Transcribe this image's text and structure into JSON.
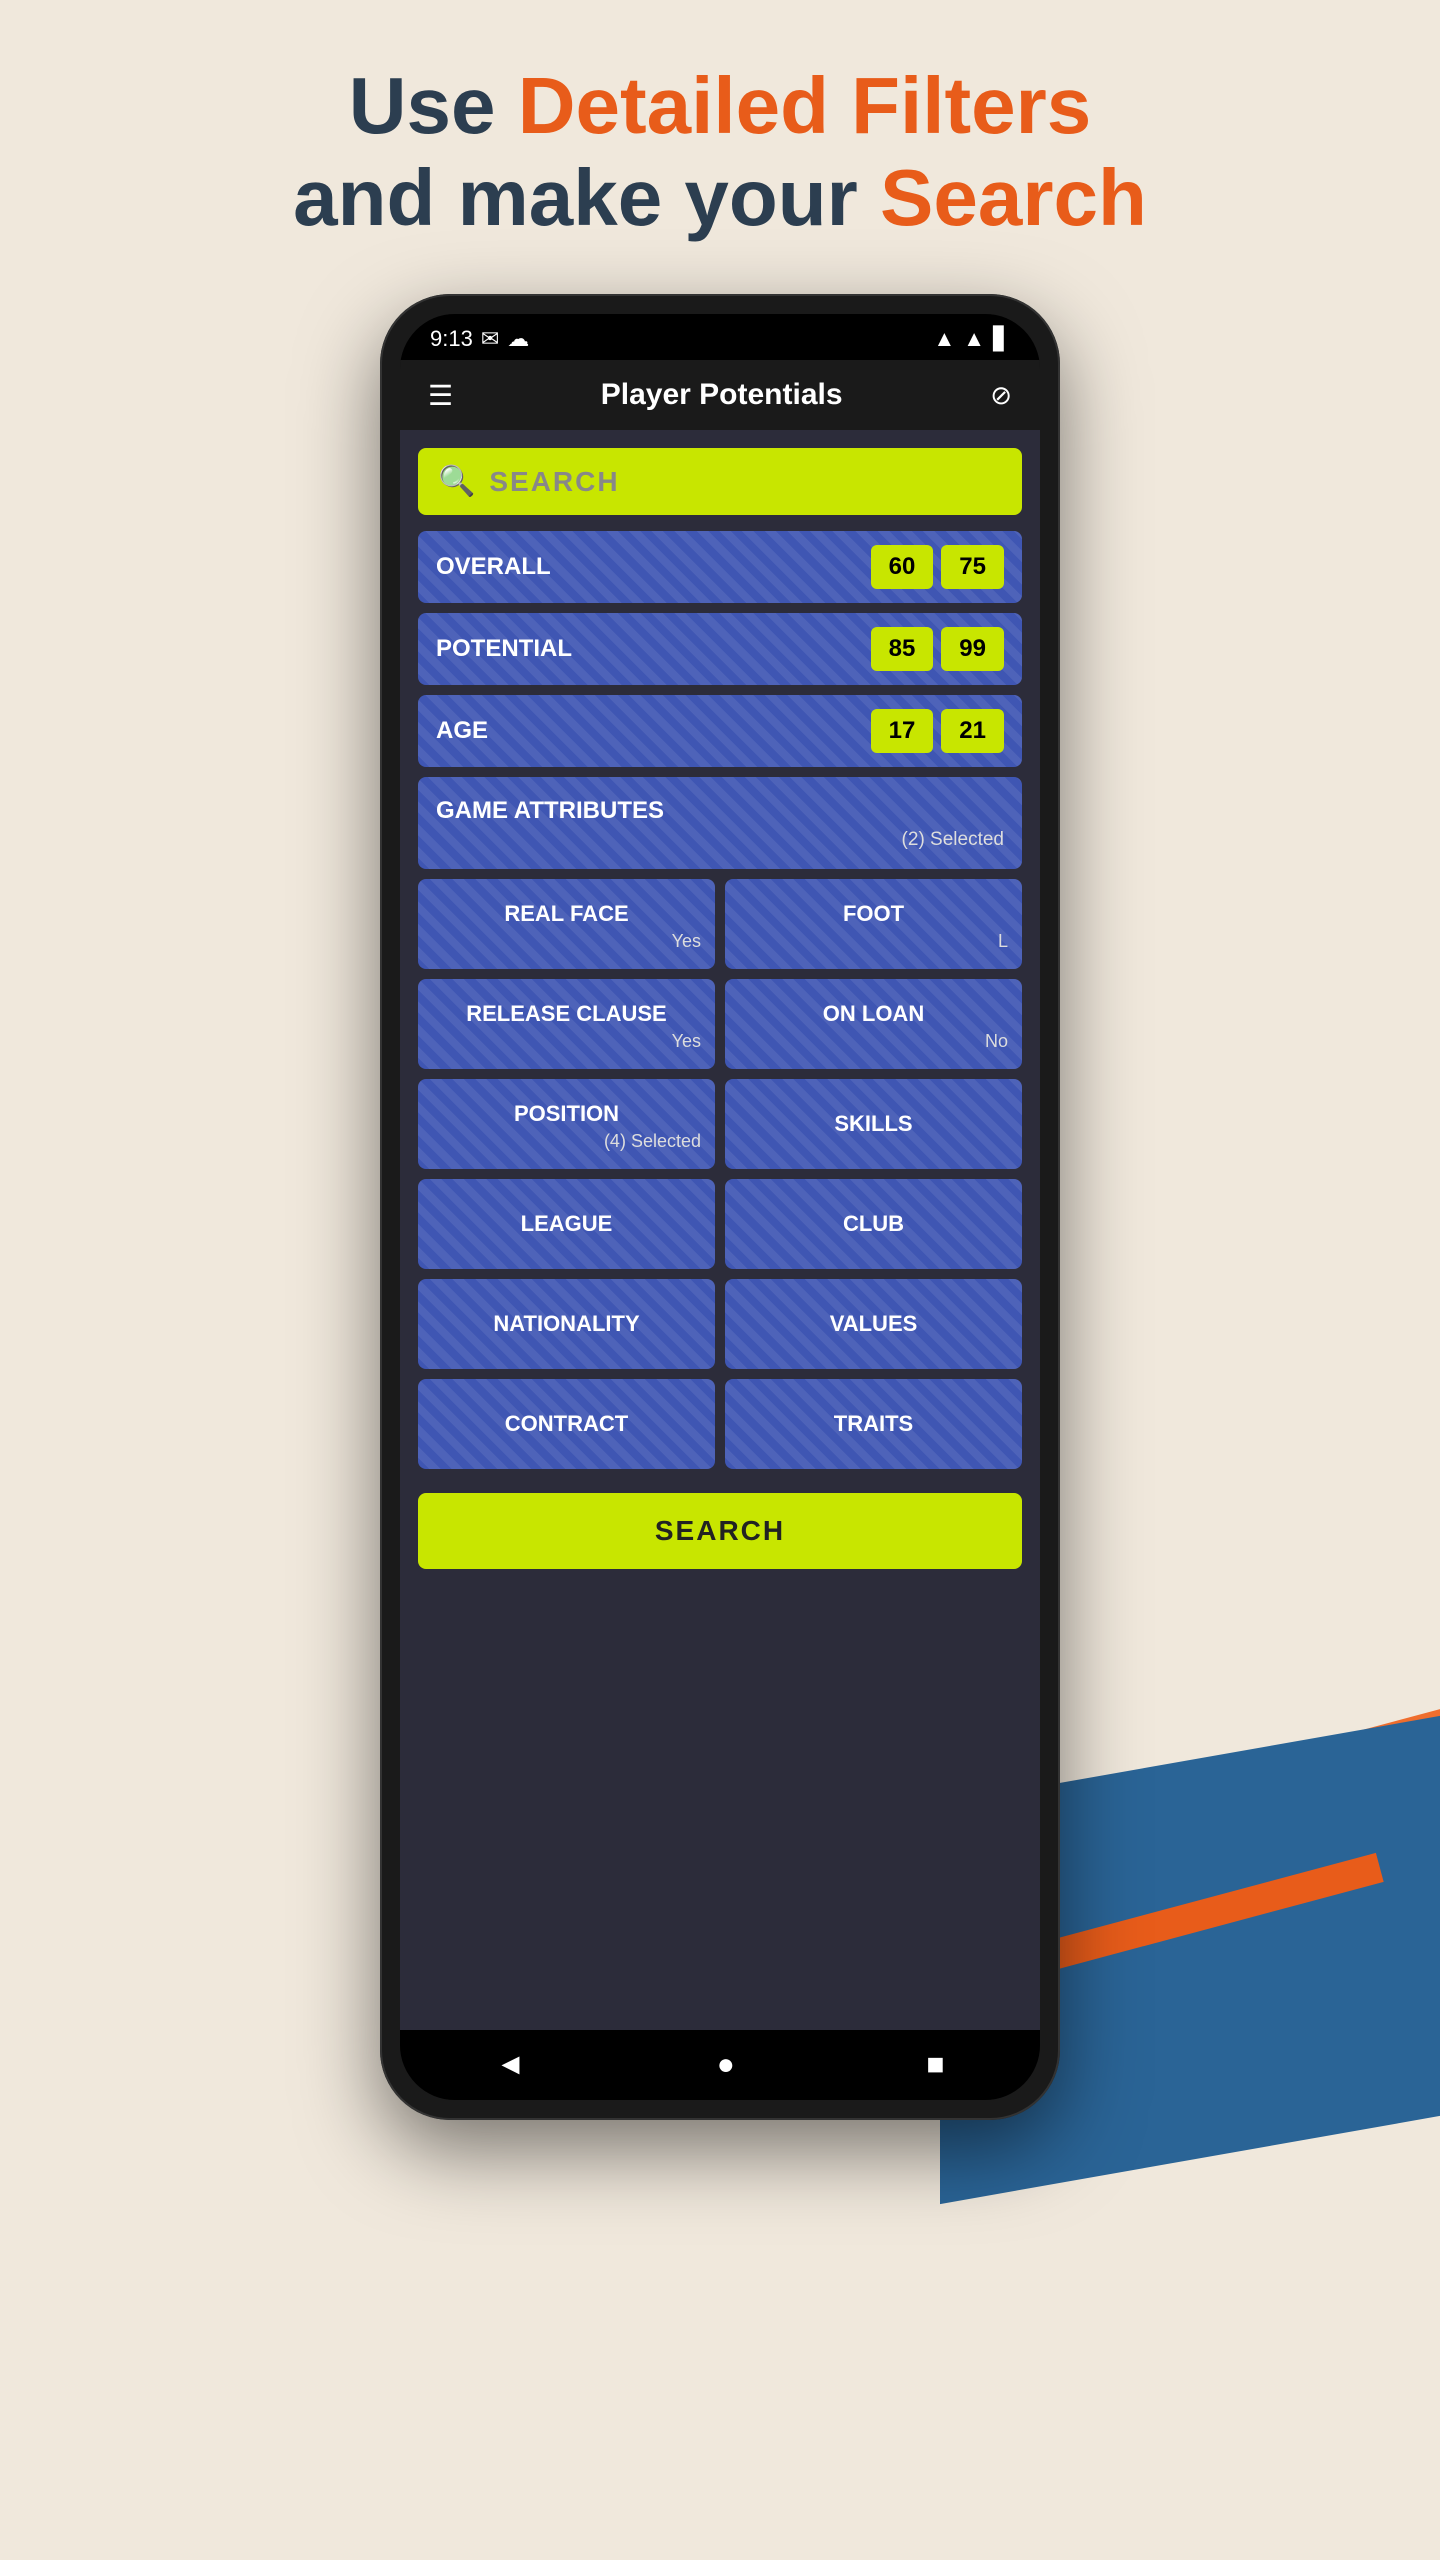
{
  "page": {
    "header_line1_part1": "Use ",
    "header_line1_part2": "Detailed Filters",
    "header_line2_part1": "and make your ",
    "header_line2_part2": "Search"
  },
  "status_bar": {
    "time": "9:13",
    "wifi": "▲",
    "signal": "▲",
    "battery": "🔋"
  },
  "nav": {
    "title": "Player Potentials",
    "filter_icon": "⊘"
  },
  "search": {
    "placeholder": "SEARCH"
  },
  "filters": {
    "overall": {
      "label": "OVERALL",
      "min": "60",
      "max": "75"
    },
    "potential": {
      "label": "POTENTIAL",
      "min": "85",
      "max": "99"
    },
    "age": {
      "label": "AGE",
      "min": "17",
      "max": "21"
    },
    "game_attributes": {
      "label": "GAME ATTRIBUTES",
      "sub": "(2) Selected"
    },
    "real_face": {
      "label": "REAL FACE",
      "sub": "Yes"
    },
    "foot": {
      "label": "FOOT",
      "sub": "L"
    },
    "release_clause": {
      "label": "RELEASE CLAUSE",
      "sub": "Yes"
    },
    "on_loan": {
      "label": "ON LOAN",
      "sub": "No"
    },
    "position": {
      "label": "POSITION",
      "sub": "(4) Selected"
    },
    "skills": {
      "label": "SKILLS",
      "sub": ""
    },
    "league": {
      "label": "LEAGUE",
      "sub": ""
    },
    "club": {
      "label": "CLUB",
      "sub": ""
    },
    "nationality": {
      "label": "NATIONALITY",
      "sub": ""
    },
    "values": {
      "label": "VALUES",
      "sub": ""
    },
    "contract": {
      "label": "CONTRACT",
      "sub": ""
    },
    "traits": {
      "label": "TRAITS",
      "sub": ""
    }
  },
  "search_button": {
    "label": "SEARCH"
  }
}
